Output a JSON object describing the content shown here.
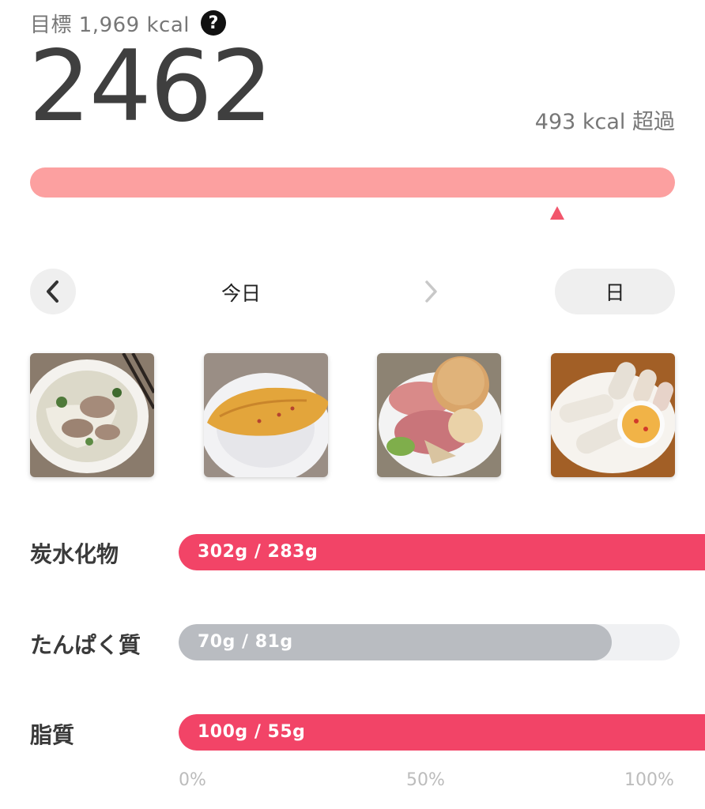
{
  "header": {
    "goal_text": "目標 1,969 kcal",
    "help_glyph": "?",
    "calories": "2462",
    "over_text": "493 kcal 超過"
  },
  "calorie_bar": {
    "intake": 2462,
    "goal": 1969,
    "color": "#fca0a0",
    "marker_color": "#f2566c"
  },
  "date_nav": {
    "label": "今日",
    "prev_icon": "chevron-left-icon",
    "next_icon": "chevron-right-icon",
    "period": "日"
  },
  "meals": [
    {
      "name": "pho-noodle-soup"
    },
    {
      "name": "omelette"
    },
    {
      "name": "ham-and-bread-plate"
    },
    {
      "name": "spring-rolls"
    }
  ],
  "macros": [
    {
      "label": "炭水化物",
      "text": "302g / 283g",
      "current": 302,
      "target": 283,
      "color": "#f24467"
    },
    {
      "label": "たんぱく質",
      "text": "70g / 81g",
      "current": 70,
      "target": 81,
      "color": "#b9bcc1"
    },
    {
      "label": "脂質",
      "text": "100g / 55g",
      "current": 100,
      "target": 55,
      "color": "#f24467"
    }
  ],
  "axis": [
    "0%",
    "50%",
    "100%"
  ]
}
